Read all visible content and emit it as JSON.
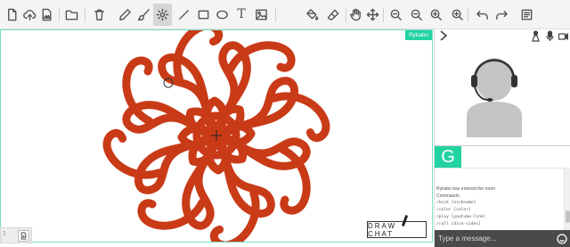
{
  "toolbar": {
    "tools": [
      {
        "name": "new-file-icon"
      },
      {
        "name": "upload-cloud-icon"
      },
      {
        "name": "image-file-icon"
      },
      {
        "name": "folder-icon"
      },
      {
        "name": "trash-icon"
      },
      {
        "name": "pencil-icon"
      },
      {
        "name": "brush-icon"
      },
      {
        "name": "gear-icon",
        "active": true
      },
      {
        "name": "line-icon"
      },
      {
        "name": "rectangle-icon"
      },
      {
        "name": "ellipse-icon"
      },
      {
        "name": "text-icon",
        "glyph": "T"
      },
      {
        "name": "picture-icon"
      },
      {
        "name": "fill-bucket-icon"
      },
      {
        "name": "eraser-icon"
      },
      {
        "name": "hand-pan-icon"
      },
      {
        "name": "move-arrows-icon"
      },
      {
        "name": "zoom-fit-icon"
      },
      {
        "name": "zoom-out-icon"
      },
      {
        "name": "zoom-in-icon"
      },
      {
        "name": "undo-icon"
      },
      {
        "name": "redo-icon"
      },
      {
        "name": "layers-icon"
      }
    ]
  },
  "canvas": {
    "user_tag": "Rykabo",
    "watermark": "DRAW CHAT",
    "stroke_color": "#c93a17"
  },
  "pages": {
    "current": "1"
  },
  "panel": {
    "avatar_label": "headset-user-avatar",
    "badge_letter": "G",
    "chat": [
      "Rykabo has entered the room",
      "Commands:",
      "/kick [nickname]",
      "/color [color]",
      "/play [youtube-link]",
      "/roll [dice-sides]"
    ],
    "input_placeholder": "Type a message...",
    "accent": "#22d3a2"
  }
}
